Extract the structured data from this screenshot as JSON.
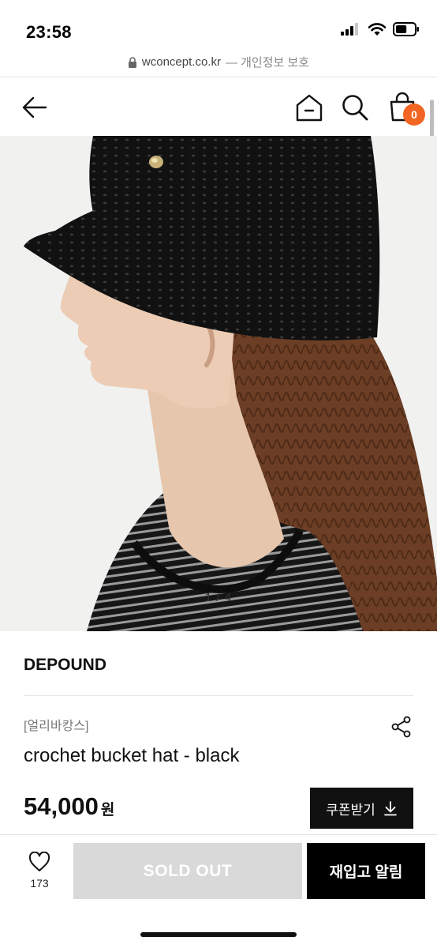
{
  "status_bar": {
    "time": "23:58",
    "battery_level": 0.6
  },
  "url_bar": {
    "domain": "wconcept.co.kr",
    "note": "— 개인정보 보호"
  },
  "header": {
    "cart_count": "0",
    "icons": [
      "back-arrow-icon",
      "home-icon",
      "search-icon",
      "shopping-bag-icon"
    ],
    "accent_color": "#f26522"
  },
  "gallery": {
    "counter": "1 / 4"
  },
  "product": {
    "brand": "DEPOUND",
    "tagline": "[얼리바캉스]",
    "name": "crochet bucket hat - black",
    "price": "54,000",
    "price_unit": "원",
    "coupon_label": "쿠폰받기"
  },
  "bottom_bar": {
    "like_count": "173",
    "sold_out_label": "SOLD OUT",
    "restock_label": "재입고 알림"
  }
}
